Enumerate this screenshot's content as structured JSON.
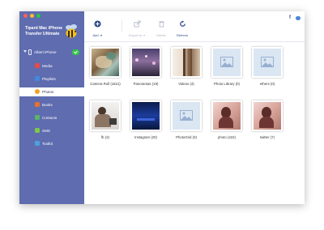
{
  "app": {
    "name_line1": "Tipard Mac iPhone",
    "name_line2": "Transfer Ultimate"
  },
  "device": {
    "name": "Albert iPhone"
  },
  "sidebar": {
    "items": [
      {
        "label": "Media",
        "icon": "music-icon",
        "color": "#e94a4a"
      },
      {
        "label": "Playlists",
        "icon": "playlist-icon",
        "color": "#3d8be0"
      },
      {
        "label": "Photos",
        "icon": "photos-icon",
        "color": "#f5a21f"
      },
      {
        "label": "Books",
        "icon": "book-icon",
        "color": "#e8712b"
      },
      {
        "label": "Contacts",
        "icon": "contacts-icon",
        "color": "#57b66a"
      },
      {
        "label": "SMS",
        "icon": "sms-icon",
        "color": "#7cc84a"
      },
      {
        "label": "Toolkit",
        "icon": "toolkit-icon",
        "color": "#4aa3df"
      }
    ],
    "active": "Photos"
  },
  "toolbar": {
    "add": "Add",
    "export": "Export to",
    "delete": "Delete",
    "refresh": "Refresh"
  },
  "albums": [
    {
      "label": "Camera Roll (1621)",
      "kind": "photo",
      "art": "camera-roll"
    },
    {
      "label": "Panoramas (19)",
      "kind": "photo",
      "art": "panorama"
    },
    {
      "label": "Videos (4)",
      "kind": "photo",
      "art": "videos"
    },
    {
      "label": "Photo Library (0)",
      "kind": "placeholder"
    },
    {
      "label": "ethers (0)",
      "kind": "placeholder"
    },
    {
      "label": "fb (2)",
      "kind": "photo",
      "art": "fb"
    },
    {
      "label": "Instagram (20)",
      "kind": "photo",
      "art": "instagram"
    },
    {
      "label": "PhotoGrid (0)",
      "kind": "placeholder"
    },
    {
      "label": "photo (422)",
      "kind": "photo",
      "art": "portrait"
    },
    {
      "label": "twitter (7)",
      "kind": "photo",
      "art": "portrait"
    }
  ],
  "colors": {
    "sidebar": "#5f6caf",
    "accent": "#2f4a86",
    "placeholder": "#dbe6f3"
  }
}
